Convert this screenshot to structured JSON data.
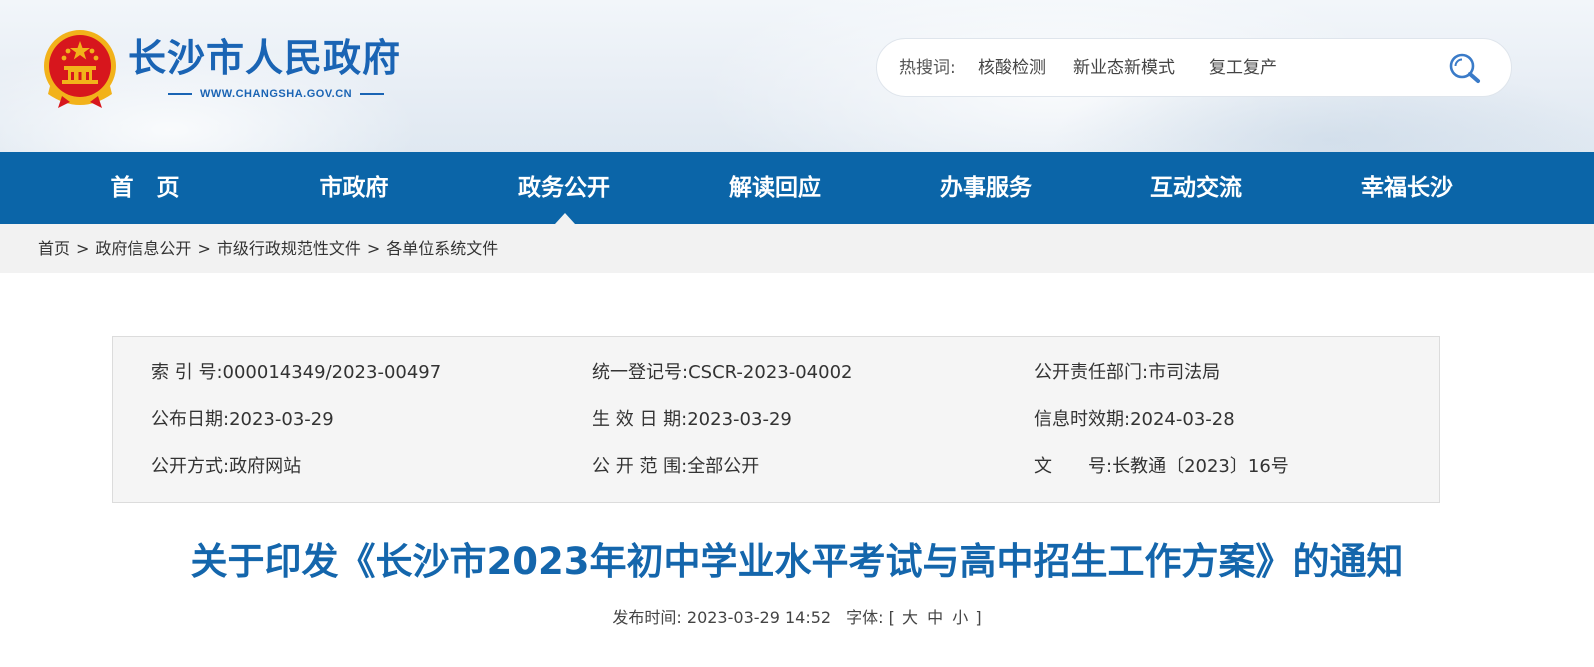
{
  "header": {
    "site_title": "长沙市人民政府",
    "site_url": "WWW.CHANGSHA.GOV.CN",
    "search": {
      "hot_label": "热搜词:",
      "hot_words": [
        "核酸检测",
        "新业态新模式",
        "复工复产"
      ]
    }
  },
  "nav": {
    "items": [
      {
        "label": "首　页"
      },
      {
        "label": "市政府"
      },
      {
        "label": "政务公开"
      },
      {
        "label": "解读回应"
      },
      {
        "label": "办事服务"
      },
      {
        "label": "互动交流"
      },
      {
        "label": "幸福长沙"
      }
    ],
    "active_index": 2
  },
  "breadcrumb": {
    "items": [
      "首页",
      "政府信息公开",
      "市级行政规范性文件",
      "各单位系统文件"
    ],
    "separator": ">"
  },
  "meta": {
    "index_no": {
      "key": "索 引 号:",
      "value": "000014349/2023-00497"
    },
    "unified_reg_no": {
      "key": "统一登记号:",
      "value": "CSCR-2023-04002"
    },
    "dept": {
      "key": "公开责任部门:",
      "value": "市司法局"
    },
    "publish_date": {
      "key": "公布日期:",
      "value": "2023-03-29"
    },
    "effective_date": {
      "key": "生 效 日 期:",
      "value": "2023-03-29"
    },
    "validity": {
      "key": "信息时效期:",
      "value": "2024-03-28"
    },
    "method": {
      "key": "公开方式:",
      "value": "政府网站"
    },
    "scope": {
      "key": "公 开 范 围:",
      "value": "全部公开"
    },
    "doc_no": {
      "key": "文　　号:",
      "value": "长教通〔2023〕16号"
    }
  },
  "article": {
    "title": "关于印发《长沙市2023年初中学业水平考试与高中招生工作方案》的通知",
    "publish_label": "发布时间:",
    "publish_time": "2023-03-29 14:52",
    "font_label": "字体:",
    "font_open": "[",
    "font_large": "大",
    "font_medium": "中",
    "font_small": "小",
    "font_close": "]"
  },
  "colors": {
    "nav_bg": "#0b65a8",
    "title_blue": "#1466ac",
    "logo_blue": "#1a64b4",
    "emblem_red": "#d7161d",
    "emblem_gold": "#f2b21a"
  },
  "icons": {
    "emblem": "national-emblem-icon",
    "search": "search-icon"
  }
}
